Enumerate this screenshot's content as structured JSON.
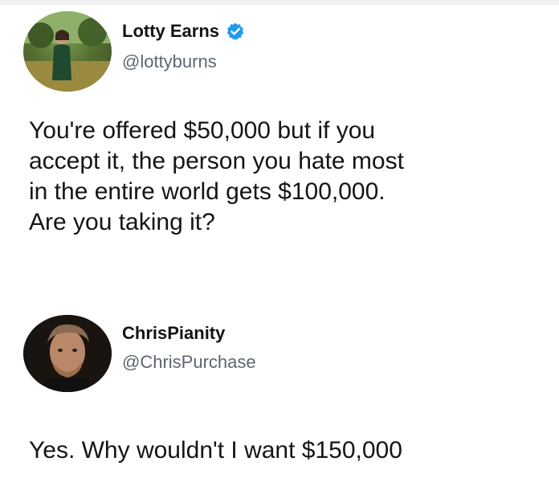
{
  "tweets": [
    {
      "display_name": "Lotty Earns",
      "handle": "@lottyburns",
      "verified": true,
      "text": "You're offered $50,000 but if you\naccept it, the person you hate most\nin the entire world gets $100,000.\nAre you taking it?",
      "avatar": "profile-photo"
    },
    {
      "display_name": "ChrisPianity",
      "handle": "@ChrisPurchase",
      "verified": false,
      "text": "Yes. Why wouldn't I want $150,000",
      "avatar": "profile-photo"
    }
  ],
  "colors": {
    "verified_badge": "#1d9bf0",
    "handle": "#5c6670",
    "text": "#151515"
  }
}
